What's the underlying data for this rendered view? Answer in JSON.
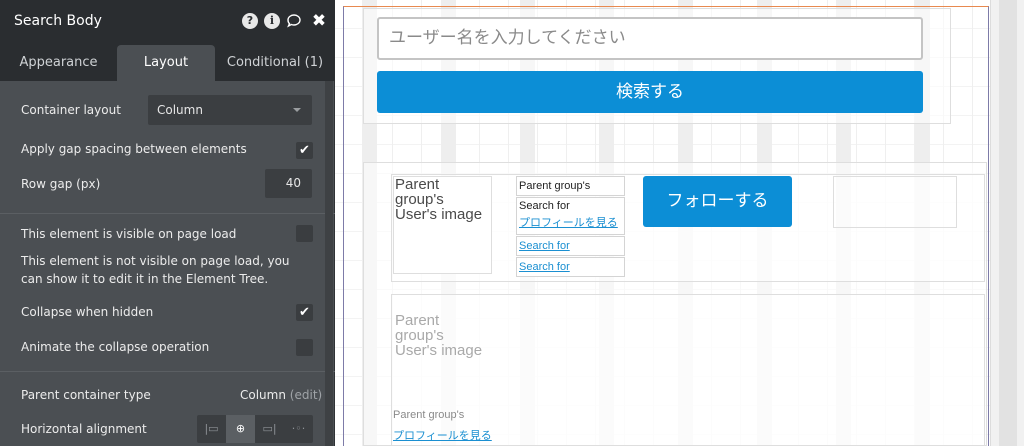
{
  "panel": {
    "title": "Search Body",
    "icons": {
      "help": "?",
      "info": "i",
      "comment": "⌕",
      "close": "✖"
    },
    "tabs": {
      "appearance": "Appearance",
      "layout": "Layout",
      "conditional": "Conditional (1)"
    },
    "container_layout_label": "Container layout",
    "container_layout_value": "Column",
    "gap_spacing_label": "Apply gap spacing between elements",
    "row_gap_label": "Row gap (px)",
    "row_gap_value": "40",
    "visible_label": "This element is visible on page load",
    "not_visible_desc": "This element is not visible on page load, you can show it to edit it in the Element Tree.",
    "collapse_label": "Collapse when hidden",
    "animate_label": "Animate the collapse operation",
    "parent_type_label": "Parent container type",
    "parent_type_value": "Column",
    "parent_type_edit": "(edit)",
    "horizontal_alignment_label": "Horizontal alignment",
    "check_mark": "✔"
  },
  "canvas": {
    "search_placeholder": "ユーザー名を入力してください",
    "search_button": "検索する",
    "follow_button": "フォローする",
    "image_placeholder_lines": [
      "Parent",
      "group's",
      "User's image"
    ],
    "parent_group_text": "Parent group's",
    "search_for_text": "Search for",
    "profile_link": "プロフィールを見る",
    "search_for_link_1": "Search for",
    "search_for_link_2": "Search for",
    "faded_image_lines": [
      "Parent",
      "group's",
      "User's image"
    ],
    "bottom_parent_group_text": "Parent group's",
    "bottom_profile_link": "プロフィールを見る"
  }
}
